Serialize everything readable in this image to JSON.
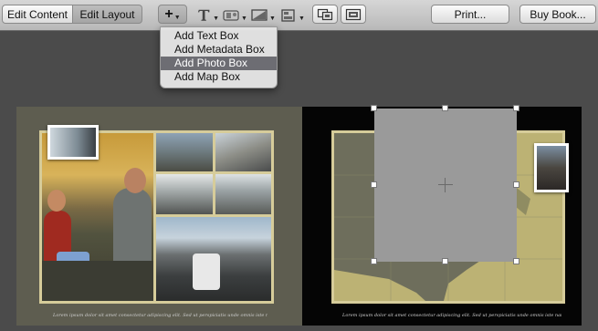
{
  "toolbar": {
    "edit_content": "Edit Content",
    "edit_layout": "Edit Layout",
    "add_button": "+",
    "print": "Print...",
    "buy_book": "Buy Book..."
  },
  "add_menu": {
    "items": [
      "Add Text Box",
      "Add Metadata Box",
      "Add Photo Box",
      "Add Map Box"
    ],
    "selected_index": 2
  },
  "icons": [
    "add-icon",
    "text-icon",
    "metadata-icon",
    "background-icon",
    "layout-icon",
    "page-layout-icon",
    "spread-layout-icon",
    "crosshair-icon"
  ],
  "colors": {
    "mat": "#d6cc9a",
    "left_page": "#5e5d50",
    "right_page": "#050505",
    "menu_highlight": "#6d6d73",
    "empty_photo_box": "#9a9a9a"
  },
  "pages": {
    "left_caption": "Lorem ipsum dolor sit amet consectetur adipiscing elit. Sed ut perspiciatis unde omnis iste natus. Nemo enim ipsam voluptatem.",
    "right_caption": "Lorem ipsum dolor sit amet consectetur adipiscing elit. Sed ut perspiciatis unde omnis iste natus error. Nemo enim ipsam."
  }
}
